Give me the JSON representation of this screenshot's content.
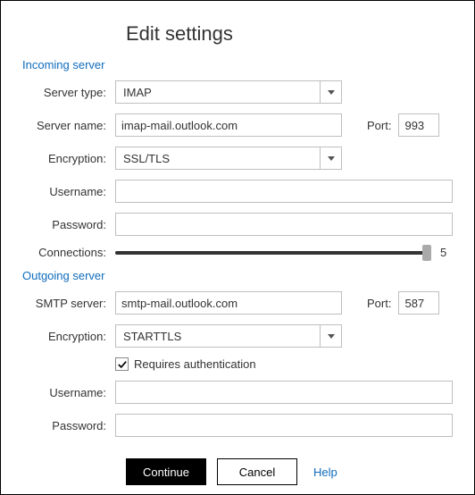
{
  "title": "Edit settings",
  "incoming": {
    "header": "Incoming server",
    "server_type_label": "Server type:",
    "server_type_value": "IMAP",
    "server_name_label": "Server name:",
    "server_name_value": "imap-mail.outlook.com",
    "port_label": "Port:",
    "port_value": "993",
    "encryption_label": "Encryption:",
    "encryption_value": "SSL/TLS",
    "username_label": "Username:",
    "username_value": "",
    "password_label": "Password:",
    "password_value": "",
    "connections_label": "Connections:",
    "connections_value": "5"
  },
  "outgoing": {
    "header": "Outgoing server",
    "smtp_label": "SMTP server:",
    "smtp_value": "smtp-mail.outlook.com",
    "port_label": "Port:",
    "port_value": "587",
    "encryption_label": "Encryption:",
    "encryption_value": "STARTTLS",
    "requires_auth_label": "Requires authentication",
    "requires_auth_checked": true,
    "username_label": "Username:",
    "username_value": "",
    "password_label": "Password:",
    "password_value": ""
  },
  "buttons": {
    "continue": "Continue",
    "cancel": "Cancel",
    "help": "Help"
  }
}
